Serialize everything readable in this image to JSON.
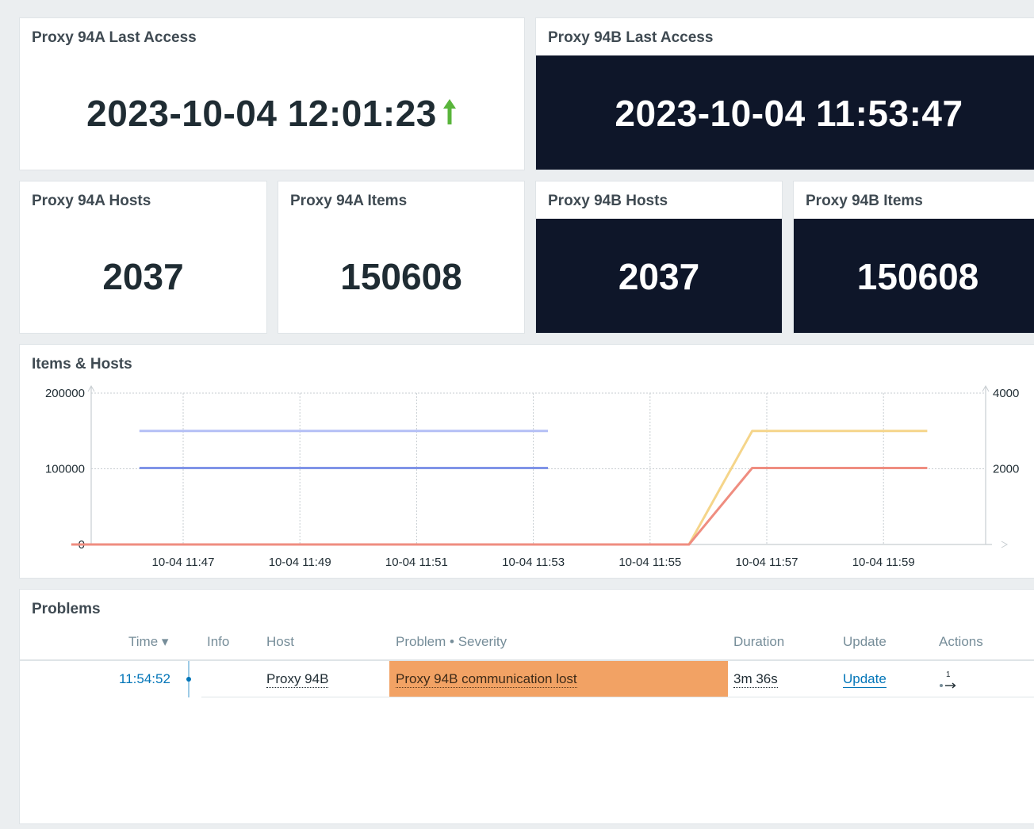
{
  "widgets": {
    "proxy_a_last_access": {
      "title": "Proxy 94A Last Access",
      "value": "2023-10-04 12:01:23",
      "trend": "up"
    },
    "proxy_b_last_access": {
      "title": "Proxy 94B Last Access",
      "value": "2023-10-04 11:53:47"
    },
    "proxy_a_hosts": {
      "title": "Proxy 94A Hosts",
      "value": "2037"
    },
    "proxy_a_items": {
      "title": "Proxy 94A Items",
      "value": "150608"
    },
    "proxy_b_hosts": {
      "title": "Proxy 94B Hosts",
      "value": "2037"
    },
    "proxy_b_items": {
      "title": "Proxy 94B Items",
      "value": "150608"
    }
  },
  "graph": {
    "title": "Items & Hosts"
  },
  "chart_data": {
    "type": "line",
    "title": "Items & Hosts",
    "x": [
      "10-04 11:47",
      "10-04 11:49",
      "10-04 11:51",
      "10-04 11:53",
      "10-04 11:55",
      "10-04 11:57",
      "10-04 11:59"
    ],
    "yleft_ticks": [
      "200000",
      "100000",
      "0"
    ],
    "yright_ticks": [
      "4000",
      "2000"
    ],
    "ylim_left": [
      0,
      200000
    ],
    "ylim_right": [
      0,
      4000
    ],
    "series": [
      {
        "axis": "left",
        "color": "#b4bff5",
        "points": [
          [
            "11:46:15",
            150000
          ],
          [
            "11:53:15",
            150000
          ]
        ]
      },
      {
        "axis": "right",
        "color": "#7f94e8",
        "points": [
          [
            "11:46:15",
            2020
          ],
          [
            "11:53:15",
            2020
          ]
        ]
      },
      {
        "axis": "left",
        "color": "#f5d58a",
        "points": [
          [
            "11:45:05",
            0
          ],
          [
            "11:55:40",
            0
          ],
          [
            "11:56:45",
            150000
          ],
          [
            "11:59:45",
            150000
          ]
        ]
      },
      {
        "axis": "right",
        "color": "#ef8d80",
        "points": [
          [
            "11:45:05",
            0
          ],
          [
            "11:55:40",
            0
          ],
          [
            "11:56:45",
            2020
          ],
          [
            "11:59:45",
            2020
          ]
        ]
      }
    ],
    "grid": true
  },
  "problems": {
    "title": "Problems",
    "columns": {
      "time": "Time ▾",
      "info": "Info",
      "host": "Host",
      "problem": "Problem • Severity",
      "duration": "Duration",
      "update": "Update",
      "actions": "Actions"
    },
    "rows": [
      {
        "time": "11:54:52",
        "host": "Proxy 94B",
        "problem": "Proxy 94B communication lost",
        "duration": "3m 36s",
        "update": "Update",
        "actions_count": "1",
        "severity_color": "#f2a264"
      }
    ]
  },
  "colors": {
    "dark_panel": "#0e1629",
    "trend_up": "#59b53b",
    "link": "#0275b8"
  }
}
